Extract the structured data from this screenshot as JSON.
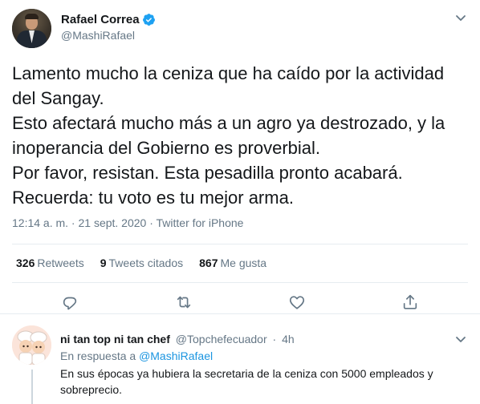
{
  "tweet": {
    "author": {
      "name": "Rafael Correa",
      "handle": "@MashiRafael",
      "verified": true
    },
    "text_lines": [
      "Lamento mucho la ceniza que ha caído por la actividad",
      "del Sangay.",
      "Esto afectará mucho más a un agro ya destrozado, y la",
      "inoperancia del Gobierno es proverbial.",
      "Por favor, resistan. Esta pesadilla pronto acabará.",
      "Recuerda: tu voto es tu mejor arma."
    ],
    "meta": "12:14 a. m. · 21 sept. 2020 · Twitter for iPhone",
    "stats": {
      "retweets_count": "326",
      "retweets_label": "Retweets",
      "quotes_count": "9",
      "quotes_label": "Tweets citados",
      "likes_count": "867",
      "likes_label": "Me gusta"
    },
    "actions": [
      "reply-icon",
      "retweet-icon",
      "like-icon",
      "share-icon"
    ]
  },
  "reply": {
    "author": {
      "name": "ni tan top ni tan chef",
      "handle": "@Topchefecuador",
      "separator": "·",
      "time": "4h"
    },
    "in_reply_label": "En respuesta a",
    "in_reply_mention": "@MashiRafael",
    "text": "En sus épocas ya hubiera la secretaria de la ceniza con 5000 empleados y sobreprecio."
  },
  "colors": {
    "accent": "#1da1f2",
    "link": "#1b95e0",
    "secondary_text": "#657786",
    "border": "#e6ecf0"
  }
}
